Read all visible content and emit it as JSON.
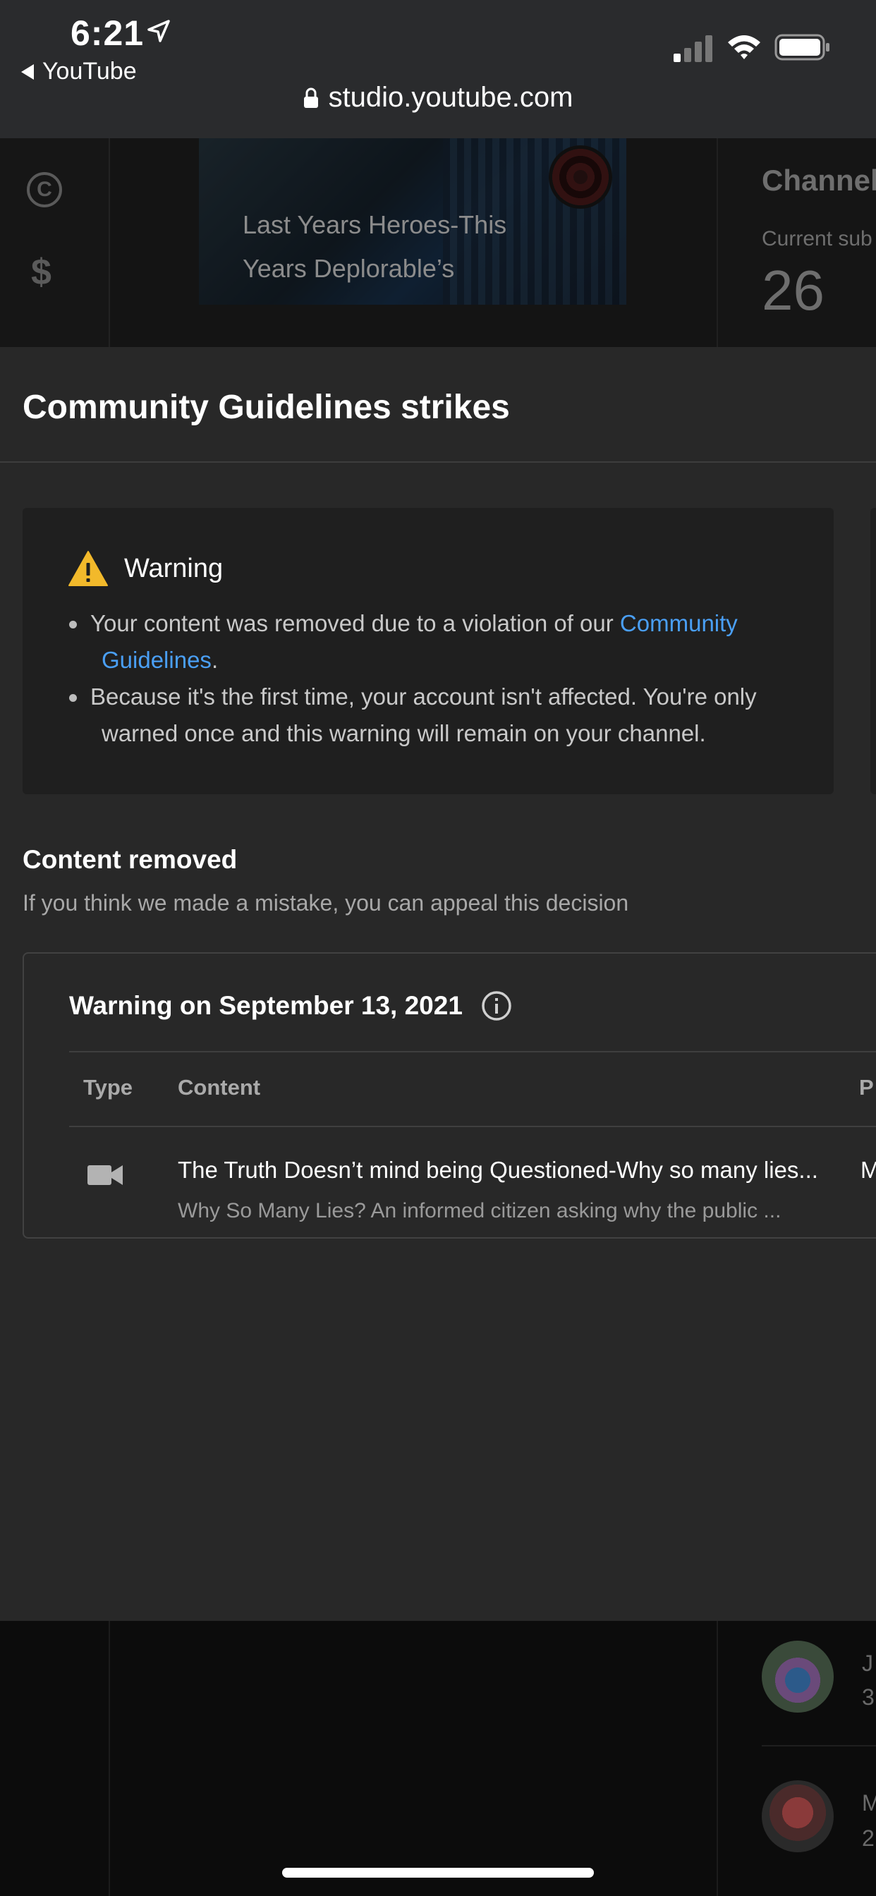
{
  "status_bar": {
    "time": "6:21",
    "back_label": "YouTube",
    "url": "studio.youtube.com"
  },
  "background_page": {
    "video_title": "Last Years Heroes-This Years Deplorable’s",
    "channel_heading": "Channel",
    "current_subs_label": "Current sub",
    "subscriber_count": "26",
    "bottom_initials": [
      "J",
      "3",
      "M",
      "2"
    ]
  },
  "sheet": {
    "title": "Community Guidelines strikes",
    "warning": {
      "title": "Warning",
      "bullet1_text": "Your content was removed due to a violation of our",
      "bullet1_link_a": "Community",
      "bullet1_link_b": "Guidelines",
      "bullet1_end": ".",
      "bullet2_line1": "Because it's the first time, your account isn't affected. You're only",
      "bullet2_line2": "warned once and this warning will remain on your channel."
    },
    "content_removed": {
      "title": "Content removed",
      "subtitle": "If you think we made a mistake, you can appeal this decision"
    },
    "strike": {
      "heading": "Warning on September 13, 2021",
      "columns": [
        "Type",
        "Content",
        "P"
      ],
      "row": {
        "title": "The Truth Doesn’t mind being Questioned-Why so many lies...",
        "description": "Why So Many Lies? An informed citizen asking why the public ...",
        "partial": "M"
      }
    }
  },
  "colors": {
    "accent_link": "#4a9ff5",
    "warning_yellow": "#f2b92b",
    "sheet_bg": "#282828"
  }
}
